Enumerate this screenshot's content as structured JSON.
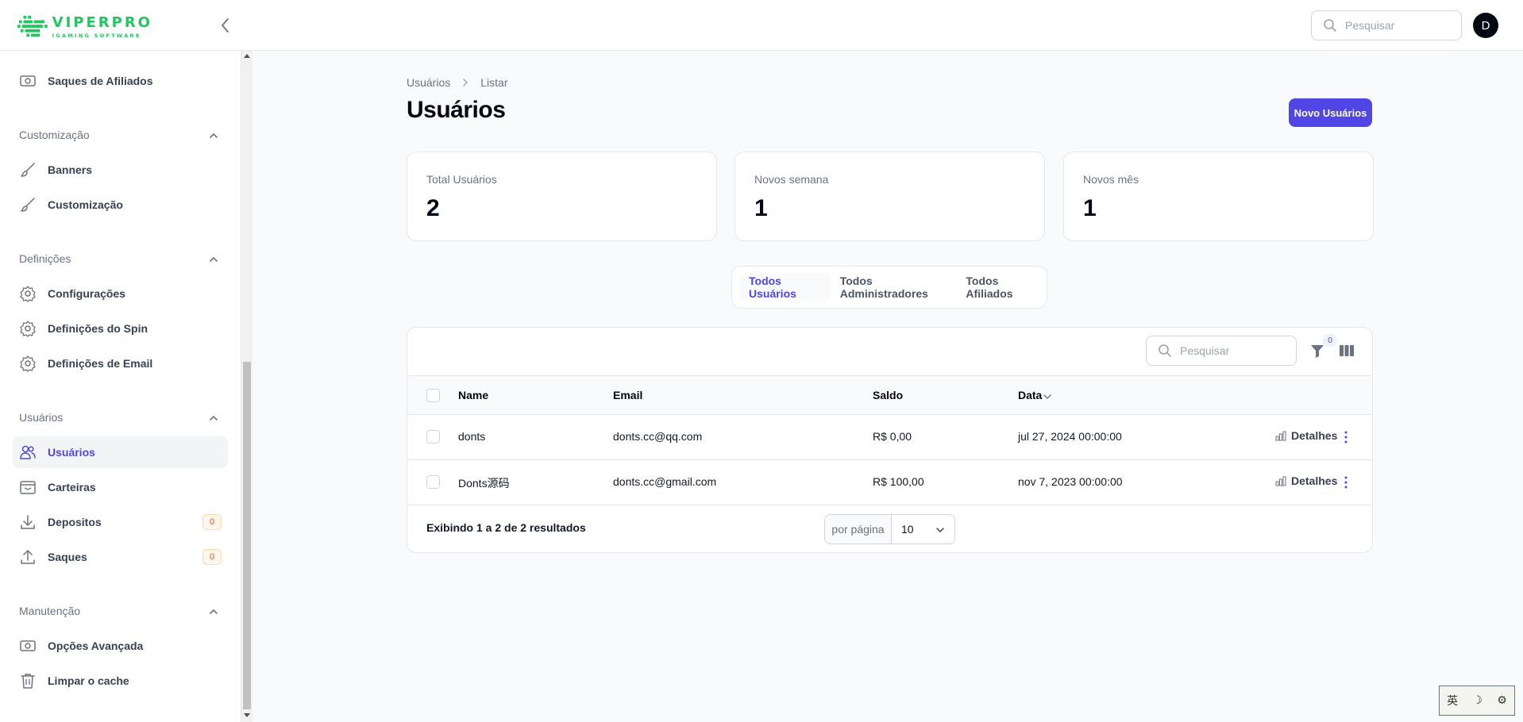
{
  "app": {
    "brand": "VIPERPRO",
    "brand_sub": "IGAMING SOFTWARE",
    "brand_color": "#22c55e",
    "accent": "#4f46e5",
    "search_placeholder": "Pesquisar",
    "avatar_initial": "D"
  },
  "sidebar": {
    "top_item": {
      "label": "Saques de Afiliados",
      "icon": "banknote-icon"
    },
    "groups": [
      {
        "label": "Customização",
        "items": [
          {
            "label": "Banners",
            "icon": "brush-icon"
          },
          {
            "label": "Customização",
            "icon": "brush-icon"
          }
        ]
      },
      {
        "label": "Definições",
        "items": [
          {
            "label": "Configurações",
            "icon": "gear-icon"
          },
          {
            "label": "Definições do Spin",
            "icon": "gear-icon"
          },
          {
            "label": "Definições de Email",
            "icon": "gear-icon"
          }
        ]
      },
      {
        "label": "Usuários",
        "items": [
          {
            "label": "Usuários",
            "icon": "users-icon",
            "active": true
          },
          {
            "label": "Carteiras",
            "icon": "inbox-icon"
          },
          {
            "label": "Depositos",
            "icon": "download-icon",
            "badge": "0"
          },
          {
            "label": "Saques",
            "icon": "upload-icon",
            "badge": "0"
          }
        ]
      },
      {
        "label": "Manutenção",
        "items": [
          {
            "label": "Opções Avançada",
            "icon": "banknote-icon"
          },
          {
            "label": "Limpar o cache",
            "icon": "trash-icon"
          }
        ]
      }
    ]
  },
  "breadcrumb": [
    "Usuários",
    "Listar"
  ],
  "page_title": "Usuários",
  "new_button": "Novo Usuários",
  "stats": [
    {
      "label": "Total Usuários",
      "value": "2"
    },
    {
      "label": "Novos semana",
      "value": "1"
    },
    {
      "label": "Novos mês",
      "value": "1"
    }
  ],
  "tabs": [
    "Todos Usuários",
    "Todos Administradores",
    "Todos Afiliados"
  ],
  "active_tab": "Todos Usuários",
  "table": {
    "search_placeholder": "Pesquisar",
    "filter_count": "0",
    "columns": [
      "Name",
      "Email",
      "Saldo",
      "Data"
    ],
    "sorted_column": "Data",
    "rows": [
      {
        "name": "donts",
        "email": "donts.cc@qq.com",
        "saldo": "R$ 0,00",
        "data": "jul 27, 2024 00:00:00",
        "action": "Detalhes"
      },
      {
        "name": "Donts源码",
        "email": "donts.cc@gmail.com",
        "saldo": "R$ 100,00",
        "data": "nov 7, 2023 00:00:00",
        "action": "Detalhes"
      }
    ],
    "footer_text": "Exibindo 1 a 2 de 2 resultados",
    "per_page_label": "por página",
    "per_page_value": "10"
  },
  "ime": [
    "英",
    "☽",
    "⚙"
  ]
}
